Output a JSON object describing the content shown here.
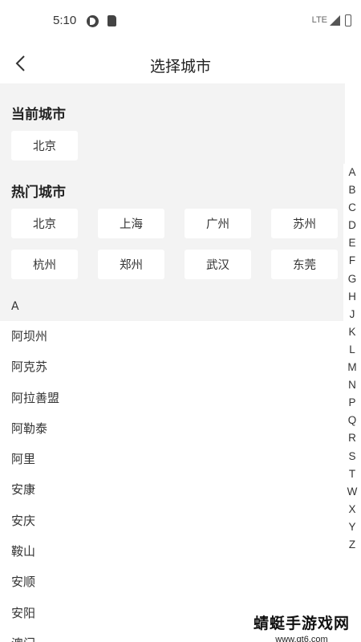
{
  "status_bar": {
    "time": "5:10",
    "network": "LTE"
  },
  "header": {
    "title": "选择城市"
  },
  "current_city": {
    "title": "当前城市",
    "city": "北京"
  },
  "hot_cities": {
    "title": "热门城市",
    "cities": [
      "北京",
      "上海",
      "广州",
      "苏州",
      "杭州",
      "郑州",
      "武汉",
      "东莞"
    ]
  },
  "city_list": {
    "group_header": "A",
    "cities": [
      "阿坝州",
      "阿克苏",
      "阿拉善盟",
      "阿勒泰",
      "阿里",
      "安康",
      "安庆",
      "鞍山",
      "安顺",
      "安阳",
      "澳门"
    ]
  },
  "index_letters": [
    "A",
    "B",
    "C",
    "D",
    "E",
    "F",
    "G",
    "H",
    "J",
    "K",
    "L",
    "M",
    "N",
    "P",
    "Q",
    "R",
    "S",
    "T",
    "W",
    "X",
    "Y",
    "Z"
  ],
  "watermark": {
    "main": "蜻蜓手游戏网",
    "sub": "www.qt6.com"
  }
}
